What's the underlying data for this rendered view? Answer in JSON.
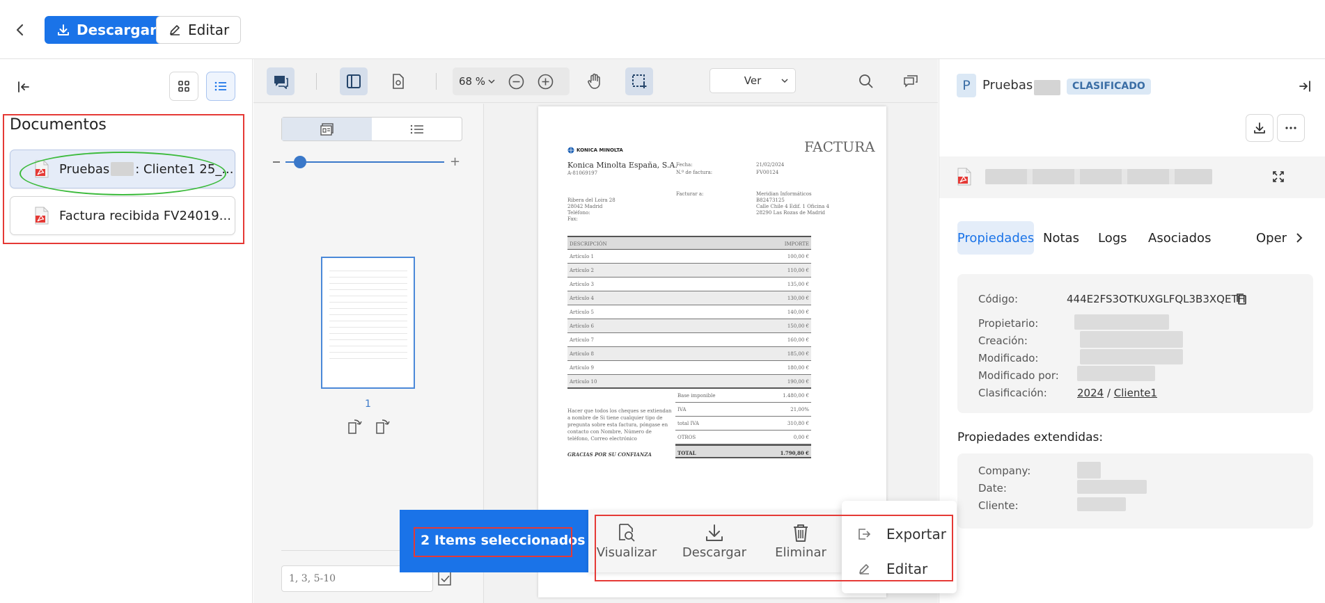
{
  "topbar": {
    "download_label": "Descargar",
    "edit_label": "Editar"
  },
  "left": {
    "title": "Documentos",
    "documents": [
      {
        "name": "Pruebas ",
        "name_suffix": ": Cliente1 25_..."
      },
      {
        "name": "Factura recibida FV24019..."
      }
    ]
  },
  "viewer": {
    "zoom": "68 %",
    "view_select": "Ver",
    "page_number": "1",
    "page_input_placeholder": "1, 3, 5-10"
  },
  "invoice": {
    "brand": "KONICA MINOLTA",
    "title": "FACTURA",
    "company": "Konica Minolta España, S.A.",
    "cif": "A-81069197",
    "fecha_label": "Fecha:",
    "fecha": "21/02/2024",
    "num_label": "N.º de factura:",
    "num": "FV00124",
    "addr": [
      "Ribera del Loira 28",
      "28042 Madrid",
      "Teléfono:",
      "Fax:"
    ],
    "facturar_label": "Facturar a:",
    "client": [
      "Meridian Informáticos",
      "B82473125",
      "Calle Chile 4 Edif. 1 Oficina 4",
      "28290 Las Rozas de Madrid"
    ],
    "col_desc": "DESCRIPCIÓN",
    "col_imp": "IMPORTE",
    "items": [
      {
        "d": "Artículo 1",
        "v": "100,00 €"
      },
      {
        "d": "Artículo 2",
        "v": "110,00 €"
      },
      {
        "d": "Artículo 3",
        "v": "135,00 €"
      },
      {
        "d": "Artículo 4",
        "v": "130,00 €"
      },
      {
        "d": "Artículo 5",
        "v": "140,00 €"
      },
      {
        "d": "Artículo 6",
        "v": "150,00 €"
      },
      {
        "d": "Artículo 7",
        "v": "160,00 €"
      },
      {
        "d": "Artículo 8",
        "v": "185,00 €"
      },
      {
        "d": "Artículo 9",
        "v": "180,00 €"
      },
      {
        "d": "Artículo 10",
        "v": "190,00 €"
      }
    ],
    "totals": [
      {
        "l": "Base imponible",
        "v": "1.480,00 €"
      },
      {
        "l": "IVA",
        "v": "21,00%"
      },
      {
        "l": "total IVA",
        "v": "310,80 €"
      },
      {
        "l": "OTROS",
        "v": "0,00 €"
      },
      {
        "l": "TOTAL",
        "v": "1.790,80 €"
      }
    ],
    "note": "Hacer que todos los cheques se extiendan a nombre de Si tiene cualquier tipo de pregunta sobre esta factura, póngase en contacto con Nombre, Número de teléfono, Correo electrónico",
    "thanks": "GRACIAS POR SU CONFIANZA"
  },
  "right": {
    "workspace_initial": "P",
    "workspace_name": "Pruebas",
    "status_badge": "CLASIFICADO",
    "tabs": [
      "Propiedades",
      "Notas",
      "Logs",
      "Asociados",
      "Oper"
    ],
    "properties": {
      "codigo_label": "Código:",
      "codigo": "444E2FS3OTKUXGLFQL3B3XQETH",
      "propietario_label": "Propietario:",
      "creacion_label": "Creación:",
      "modificado_label": "Modificado:",
      "modificado_por_label": "Modificado por:",
      "clasificacion_label": "Clasificación:",
      "clasificacion_year": "2024",
      "clasificacion_sep": " / ",
      "clasificacion_client": "Cliente1"
    },
    "extended_title": "Propiedades extendidas:",
    "extended": {
      "company_label": "Company:",
      "date_label": "Date:",
      "cliente_label": "Cliente:"
    }
  },
  "selection": {
    "count_label": "2 Items seleccionados",
    "visualize": "Visualizar",
    "download": "Descargar",
    "delete": "Eliminar"
  },
  "menu": {
    "export": "Exportar",
    "edit": "Editar"
  },
  "colors": {
    "accent": "#1a73e8",
    "badge_bg": "#dbe8f5",
    "badge_text": "#3b6ea5",
    "annotation_red": "#e53935",
    "annotation_green": "#3dbb3d"
  }
}
